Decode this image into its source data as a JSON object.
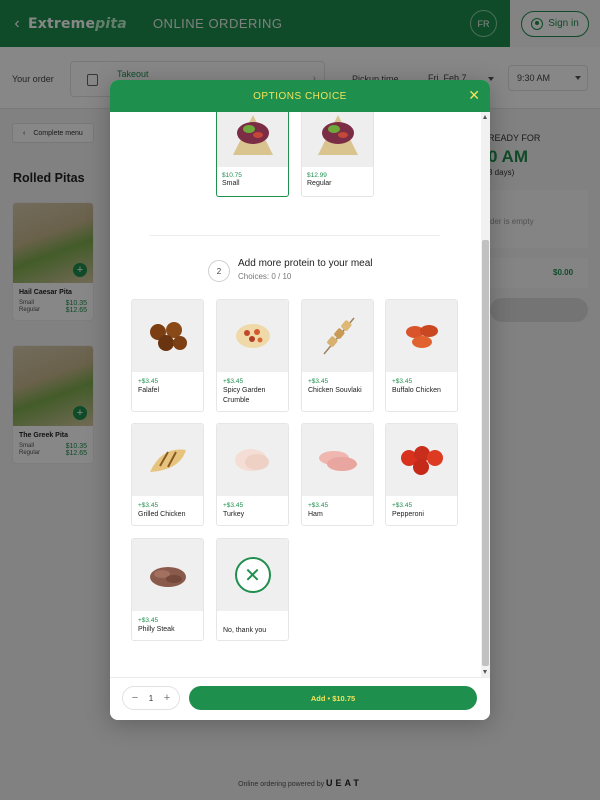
{
  "header": {
    "logo_main": "Extreme",
    "logo_accent": "pita",
    "title": "ONLINE ORDERING",
    "language": "FR",
    "signin_label": "Sign in"
  },
  "order_bar": {
    "your_order": "Your order",
    "mode": "Takeout",
    "pickup_label": "Pickup time",
    "date": "Fri, Feb 7",
    "time": "9:30 AM"
  },
  "menu": {
    "back_label": "Complete menu",
    "section_title": "Rolled Pitas",
    "products": [
      {
        "name": "Hail Caesar Pita",
        "sizes": [
          {
            "label": "Small",
            "price": "$10.35"
          },
          {
            "label": "Regular",
            "price": "$12.65"
          }
        ]
      },
      {
        "name": "The Greek Pita",
        "sizes": [
          {
            "label": "Small",
            "price": "$10.35"
          },
          {
            "label": "Regular",
            "price": "$12.65"
          }
        ]
      }
    ]
  },
  "cart": {
    "ready_for": "READY FOR",
    "ready_time": "0 AM",
    "ready_days": "3 days)",
    "empty_text": "der is empty",
    "total": "$0.00"
  },
  "modal": {
    "title": "OPTIONS CHOICE",
    "close_glyph": "✕",
    "sizes": [
      {
        "price": "$10.75",
        "label": "Small",
        "selected": true
      },
      {
        "price": "$12.99",
        "label": "Regular",
        "selected": false
      }
    ],
    "step": {
      "number": "2",
      "title": "Add more protein to your meal",
      "subtitle": "Choices: 0 / 10"
    },
    "options": [
      {
        "price": "+$3.45",
        "name": "Falafel"
      },
      {
        "price": "+$3.45",
        "name": "Spicy Garden Crumble"
      },
      {
        "price": "+$3.45",
        "name": "Chicken Souvlaki"
      },
      {
        "price": "+$3.45",
        "name": "Buffalo Chicken"
      },
      {
        "price": "+$3.45",
        "name": "Grilled Chicken"
      },
      {
        "price": "+$3.45",
        "name": "Turkey"
      },
      {
        "price": "+$3.45",
        "name": "Ham"
      },
      {
        "price": "+$3.45",
        "name": "Pepperoni"
      },
      {
        "price": "+$3.45",
        "name": "Philly Steak"
      },
      {
        "price": "",
        "name": "No, thank you"
      }
    ],
    "quantity": "1",
    "add_label": "Add • $10.75"
  },
  "footer": {
    "powered_by": "Online ordering powered by",
    "brand": "UEAT"
  },
  "colors": {
    "brand_green": "#1f8f4e",
    "accent_yellow": "#f2e45a"
  }
}
